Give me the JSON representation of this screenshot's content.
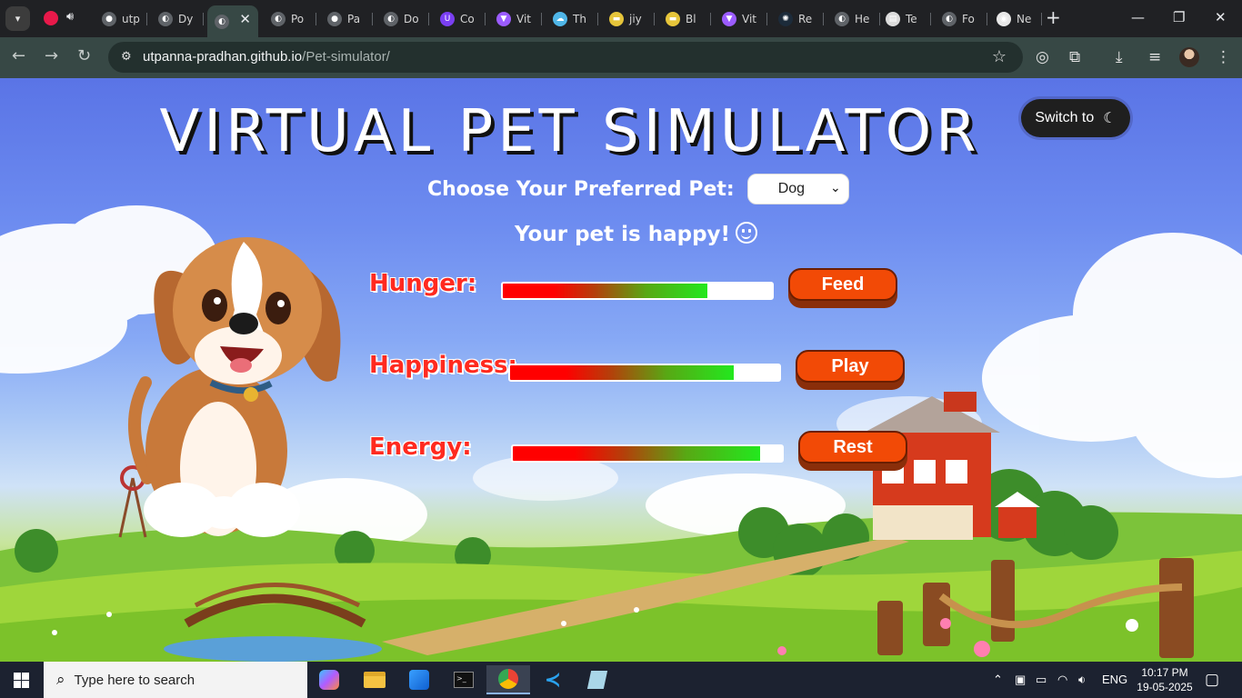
{
  "browser": {
    "tabs": [
      {
        "label": "utp",
        "icon": "github-icon"
      },
      {
        "label": "Dy",
        "icon": "globe-icon"
      },
      {
        "label": "",
        "icon": "globe-icon",
        "active": true
      },
      {
        "label": "Po",
        "icon": "globe-icon"
      },
      {
        "label": "Pa",
        "icon": "github-icon"
      },
      {
        "label": "Do",
        "icon": "globe-icon"
      },
      {
        "label": "Co",
        "icon": "shield-icon"
      },
      {
        "label": "Vit",
        "icon": "vite-icon"
      },
      {
        "label": "Th",
        "icon": "cloud-icon"
      },
      {
        "label": "jiy",
        "icon": "ticket-icon"
      },
      {
        "label": "Bl",
        "icon": "ticket-icon"
      },
      {
        "label": "Vit",
        "icon": "vite-icon"
      },
      {
        "label": "Re",
        "icon": "react-icon"
      },
      {
        "label": "He",
        "icon": "globe-icon"
      },
      {
        "label": "Te",
        "icon": "doc-icon"
      },
      {
        "label": "Fo",
        "icon": "globe-icon"
      },
      {
        "label": "Ne",
        "icon": "chrome-icon"
      }
    ],
    "url_host": "utpanna-pradhan.github.io",
    "url_path": "/Pet-simulator/"
  },
  "page": {
    "title": "VIRTUAL PET SIMULATOR",
    "theme_toggle_label": "Switch to",
    "choose_label": "Choose Your Preferred Pet:",
    "pet_selected": "Dog",
    "status": "Your pet is happy!",
    "stats": [
      {
        "label": "Hunger:",
        "level": 0.76,
        "button": "Feed"
      },
      {
        "label": "Happiness:",
        "level": 0.83,
        "button": "Play"
      },
      {
        "label": "Energy:",
        "level": 0.92,
        "button": "Rest"
      }
    ]
  },
  "taskbar": {
    "search_placeholder": "Type here to search",
    "language": "ENG",
    "time": "10:17 PM",
    "date": "19-05-2025"
  }
}
